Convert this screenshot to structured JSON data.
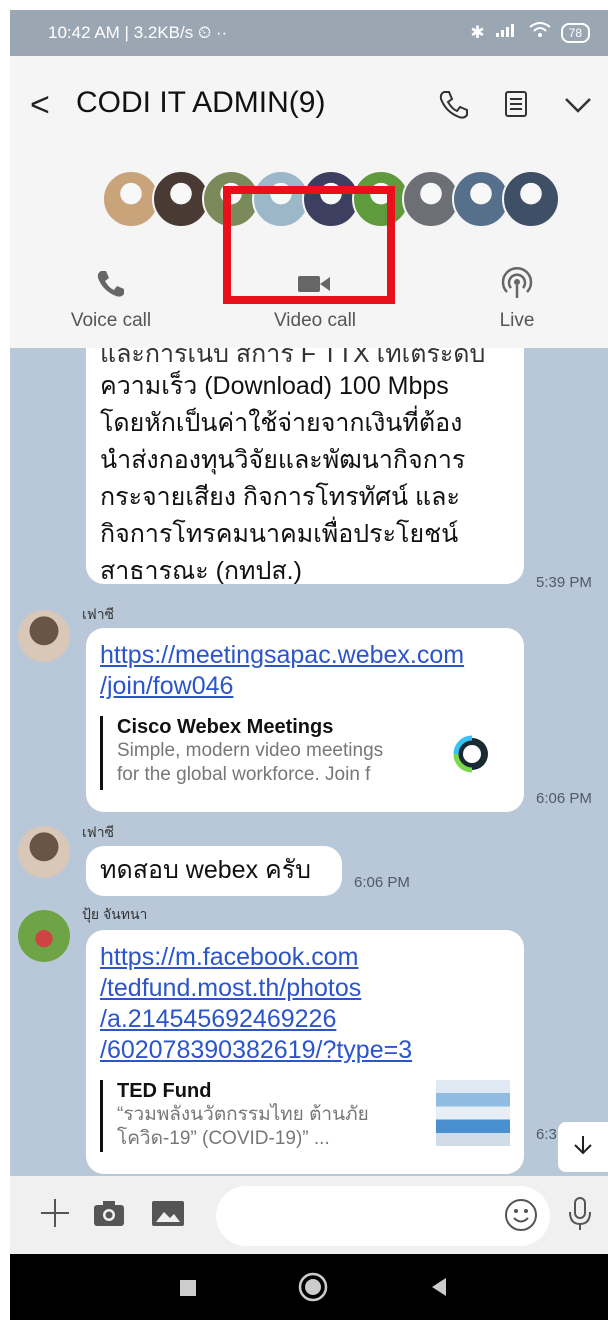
{
  "status_bar": {
    "left_text": "10:42 AM | 3.2KB/s ⏲ ··",
    "battery": "78"
  },
  "header": {
    "title": "CODI IT ADMIN(9)",
    "avatar_colors": [
      "#c9a37a",
      "#4a3a34",
      "#7b8a5a",
      "#9bb7c8",
      "#3c3f60",
      "#5f9a3c",
      "#6c6f74",
      "#56708c",
      "#3f4f66"
    ]
  },
  "call_options": {
    "voice": "Voice call",
    "video": "Video call",
    "live": "Live"
  },
  "messages": {
    "m1": {
      "partial_top": "และการเนบ สการ F TTX เทเตระดบ",
      "lines": [
        "ความเร็ว (Download) 100 Mbps",
        "โดยหักเป็นค่าใช้จ่ายจากเงินที่ต้อง",
        "นำส่งกองทุนวิจัยและพัฒนากิจการ",
        "กระจายเสียง กิจการโทรทัศน์ และ",
        "กิจการโทรคมนาคมเพื่อประโยชน์",
        "สาธารณะ (กทปส.)"
      ],
      "time": "5:39 PM"
    },
    "m2": {
      "sender": "เฟาซี",
      "link_lines": [
        "https://meetingsapac.webex.com",
        "/join/fow046"
      ],
      "preview_title": "Cisco Webex Meetings",
      "preview_desc": "Simple, modern video meetings",
      "preview_desc2": "for the global workforce. Join f",
      "time": "6:06 PM"
    },
    "m3": {
      "sender": "เฟาซี",
      "text": "ทดสอบ webex ครับ",
      "time": "6:06 PM"
    },
    "m4": {
      "sender": "ปุ้ย จันทนา",
      "link_lines": [
        "https://m.facebook.com",
        "/tedfund.most.th/photos",
        "/a.214545692469226",
        "/602078390382619/?type=3"
      ],
      "preview_title": "TED Fund",
      "preview_desc": "“รวมพลังนวัตกรรมไทย ต้านภัย",
      "preview_desc2": "โควิด-19” (COVID-19)” ...",
      "time": "6:31 PM"
    }
  }
}
